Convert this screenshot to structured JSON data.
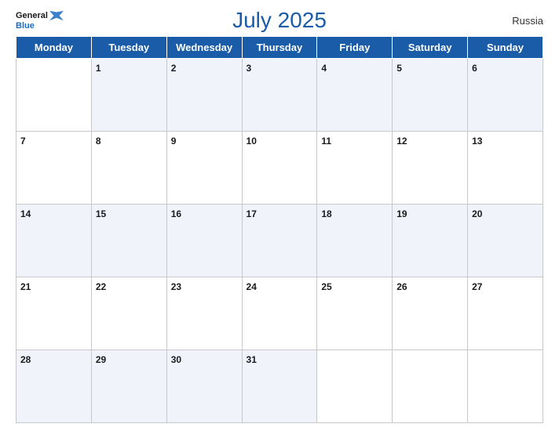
{
  "header": {
    "title": "July 2025",
    "country": "Russia",
    "logo_general": "General",
    "logo_blue": "Blue"
  },
  "days_of_week": [
    "Monday",
    "Tuesday",
    "Wednesday",
    "Thursday",
    "Friday",
    "Saturday",
    "Sunday"
  ],
  "weeks": [
    [
      null,
      1,
      2,
      3,
      4,
      5,
      6
    ],
    [
      7,
      8,
      9,
      10,
      11,
      12,
      13
    ],
    [
      14,
      15,
      16,
      17,
      18,
      19,
      20
    ],
    [
      21,
      22,
      23,
      24,
      25,
      26,
      27
    ],
    [
      28,
      29,
      30,
      31,
      null,
      null,
      null
    ]
  ]
}
